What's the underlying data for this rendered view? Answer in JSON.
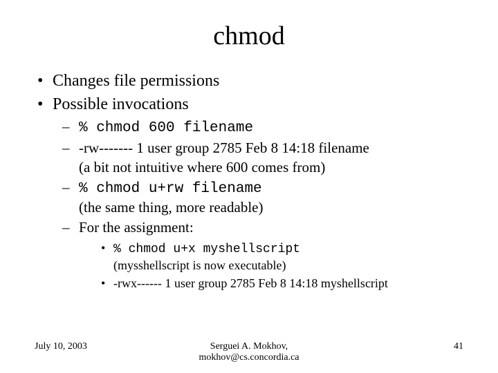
{
  "title": "chmod",
  "bullets": {
    "b1": "Changes file permissions",
    "b2": "Possible invocations",
    "s1_cmd": "% chmod 600 filename",
    "s2_line1": "-rw------- 1 user group 2785 Feb 8 14:18 filename",
    "s2_line2": "(a bit not intuitive where 600 comes from)",
    "s3_cmd": "% chmod u+rw filename",
    "s3_line2": "(the same thing, more readable)",
    "s4": "For the assignment:",
    "t1_cmd": "% chmod u+x myshellscript",
    "t1_line2": "(mysshellscript is now executable)",
    "t2": "-rwx------ 1 user group 2785 Feb 8 14:18 myshellscript"
  },
  "footer": {
    "date": "July 10, 2003",
    "author": "Serguei A. Mokhov,",
    "email": "mokhov@cs.concordia.ca",
    "page": "41"
  }
}
